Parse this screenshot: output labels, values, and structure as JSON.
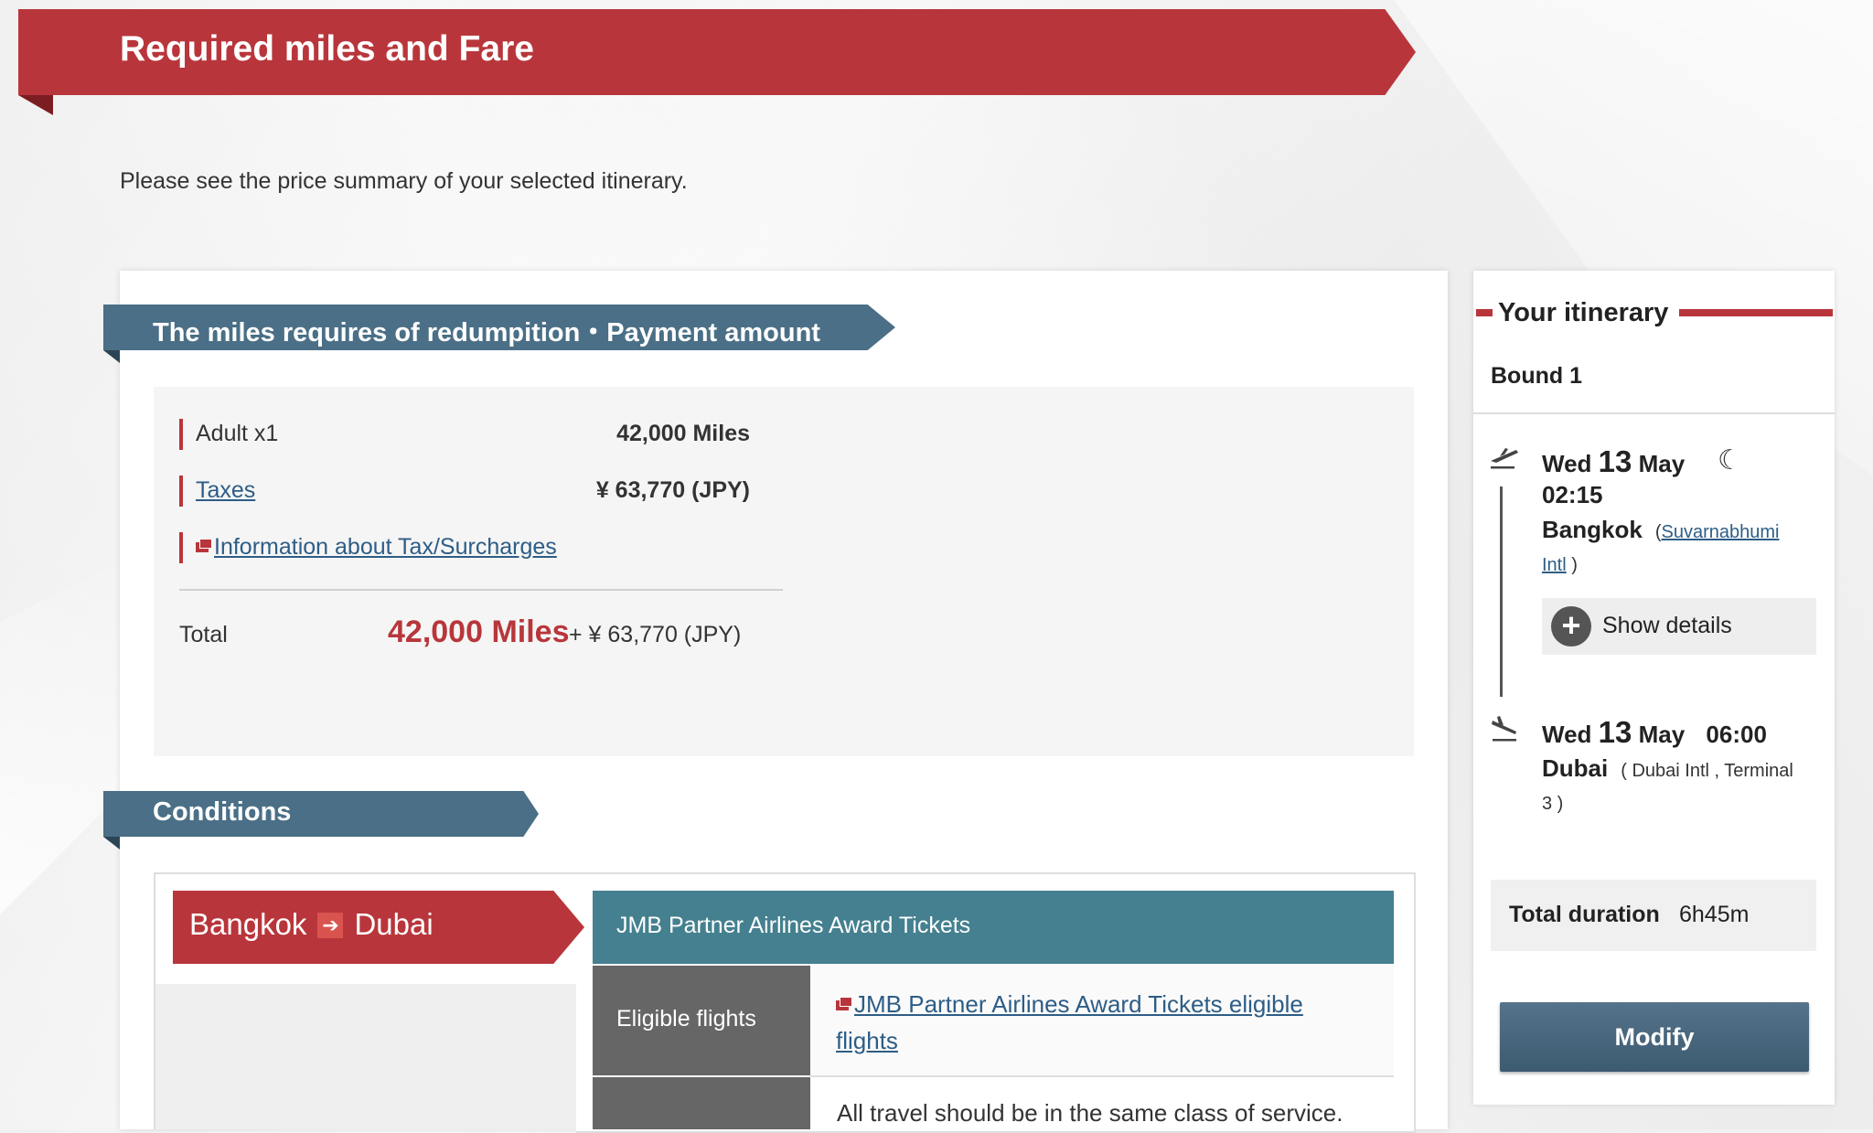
{
  "header": {
    "title": "Required miles and Fare"
  },
  "intro": "Please see the price summary of your selected itinerary.",
  "payment_section": {
    "title": "The miles requires of redumpition・Payment amount",
    "rows": [
      {
        "label": "Adult x1",
        "value": "42,000 Miles"
      },
      {
        "label": "Taxes",
        "value": "¥ 63,770 (JPY)"
      }
    ],
    "tax_info_link": "Information about Tax/Surcharges",
    "total_label": "Total",
    "total_miles": "42,000 Miles",
    "total_plus": "+ ¥ 63,770 (JPY)"
  },
  "conditions": {
    "title": "Conditions",
    "route_from": "Bangkok",
    "route_to": "Dubai",
    "award_title": "JMB Partner Airlines Award Tickets",
    "eligible_label": "Eligible flights",
    "eligible_link": "JMB Partner Airlines Award Tickets eligible flights",
    "travel_note": "All travel should be in the same class of service."
  },
  "itinerary": {
    "title": "Your itinerary",
    "bound": "Bound 1",
    "departure": {
      "weekday": "Wed",
      "day": "13",
      "month": "May",
      "time": "02:15",
      "city": "Bangkok",
      "airport_link_1": "Suvarnabhumi",
      "airport_link_2": "Intl"
    },
    "show_details": "Show details",
    "arrival": {
      "weekday": "Wed",
      "day": "13",
      "month": "May",
      "time": "06:00",
      "city": "Dubai",
      "airport": "( Dubai Intl ,  Terminal",
      "airport_cont": "3 )"
    },
    "total_duration_label": "Total duration",
    "total_duration_value": "6h45m",
    "modify_label": "Modify"
  },
  "colors": {
    "brand_red": "#b8363b",
    "section_blue": "#4a6f86",
    "teal": "#44808f"
  }
}
